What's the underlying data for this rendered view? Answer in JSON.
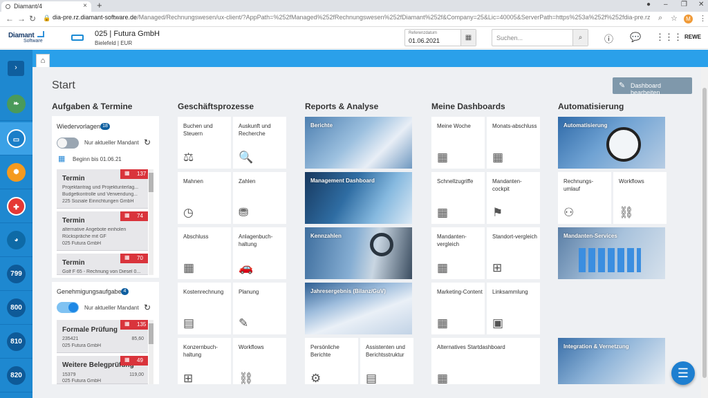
{
  "browser": {
    "tab_title": "Diamant/4",
    "url_host": "dia-pre.rz.diamant-software.de",
    "url_rest": "/Managed/Rechnungswesen/ux-client/?AppPath=%252fManaged%252fRechnungswesen%252fDiamant%252f&Company=25&Lic=40005&ServerPath=https%253a%252f%252fdia-pre.rz.diamant-software.de%252fManaged%252fRe...",
    "profile_initial": "M"
  },
  "header": {
    "logo_line1": "Diamant",
    "logo_line2": "Software",
    "company": "025 | Futura GmbH",
    "company_sub": "Bielefeld | EUR",
    "refdate_label": "Referenzdatum",
    "refdate_value": "01.06.2021",
    "search_placeholder": "Suchen...",
    "user": "REWE"
  },
  "rail": {
    "toggle_icon": "›",
    "numbered": [
      "799",
      "800",
      "810",
      "820"
    ]
  },
  "page": {
    "title": "Start",
    "edit_label": "Dashboard bearbeiten"
  },
  "columns": {
    "tasks": "Aufgaben & Termine",
    "business": "Geschäftsprozesse",
    "reports": "Reports & Analyse",
    "dashboards": "Meine Dashboards",
    "automation": "Automatisierung"
  },
  "resubmissions": {
    "title": "Wiedervorlagen",
    "count": "18",
    "toggle_label": "Nur aktueller Mandant",
    "date_label": "Beginn bis 01.06.21",
    "items": [
      {
        "title": "Termin",
        "badge": "137",
        "lines": [
          "Projektantrag und Projektunterlag...",
          "Budgetkontrolle und Verwendung...",
          "225 Soziale Einrichtungen GmbH"
        ]
      },
      {
        "title": "Termin",
        "badge": "74",
        "lines": [
          "alternative Angebote einholen",
          "Rückspräche mit GF",
          "025 Futura GmbH"
        ]
      },
      {
        "title": "Termin",
        "badge": "70",
        "lines": [
          "Golf F 65 - Rechnung von Diesel 0..."
        ]
      }
    ]
  },
  "approvals": {
    "title": "Genehmigungsaufgaben",
    "count": "4",
    "toggle_label": "Nur aktueller Mandant",
    "items": [
      {
        "title": "Formale Prüfung",
        "badge": "135",
        "lines": [
          "235421",
          "025 Futura GmbH"
        ],
        "amount": "85,60"
      },
      {
        "title": "Weitere Belegprüfung",
        "badge": "49",
        "lines": [
          "15379",
          "025 Futura GmbH"
        ],
        "amount": "119,00"
      }
    ]
  },
  "business": [
    {
      "label": "Buchen und Steuern",
      "icon": "⚖"
    },
    {
      "label": "Auskunft und Recherche",
      "icon": "🔍"
    },
    {
      "label": "Mahnen",
      "icon": "◷"
    },
    {
      "label": "Zahlen",
      "icon": "⛃"
    },
    {
      "label": "Abschluss",
      "icon": "▦"
    },
    {
      "label": "Anlagenbuch-haltung",
      "icon": "🚗"
    },
    {
      "label": "Kostenrechnung",
      "icon": "▤"
    },
    {
      "label": "Planung",
      "icon": "✎"
    },
    {
      "label": "Konzernbuch-haltung",
      "icon": "⊞"
    },
    {
      "label": "Workflows",
      "icon": "⛓"
    }
  ],
  "reports": [
    {
      "label": "Berichte"
    },
    {
      "label": "Management Dashboard"
    },
    {
      "label": "Kennzahlen"
    },
    {
      "label": "Jahresergebnis (Bilanz/GuV)"
    }
  ],
  "reports_small": [
    {
      "label": "Persönliche Berichte",
      "icon": "⚙"
    },
    {
      "label": "Assistenten und Berichtsstruktur",
      "icon": "▤"
    }
  ],
  "dashboards": [
    {
      "label": "Meine Woche",
      "icon": "▦"
    },
    {
      "label": "Monats-abschluss",
      "icon": "▦"
    },
    {
      "label": "Schnellzugriffe",
      "icon": "▦"
    },
    {
      "label": "Mandanten-cockpit",
      "icon": "⚑"
    },
    {
      "label": "Mandanten-vergleich",
      "icon": "▦"
    },
    {
      "label": "Standort-vergleich",
      "icon": "⊞"
    },
    {
      "label": "Marketing-Content",
      "icon": "▦"
    },
    {
      "label": "Linksammlung",
      "icon": "▣"
    },
    {
      "label": "Alternatives Startdashboard",
      "icon": "▦"
    }
  ],
  "automation": {
    "banner": "Automatisierung",
    "tiles": [
      {
        "label": "Rechnungs-umlauf",
        "icon": "⚇"
      },
      {
        "label": "Workflows",
        "icon": "⛓"
      }
    ],
    "services": "Mandanten-Services",
    "integration": "Integration & Vernetzung"
  },
  "colors": {
    "rail": "#1e88d0",
    "band": "#2aa0ea",
    "badge_red": "#d9343c",
    "edit_button": "#7f98ab"
  }
}
